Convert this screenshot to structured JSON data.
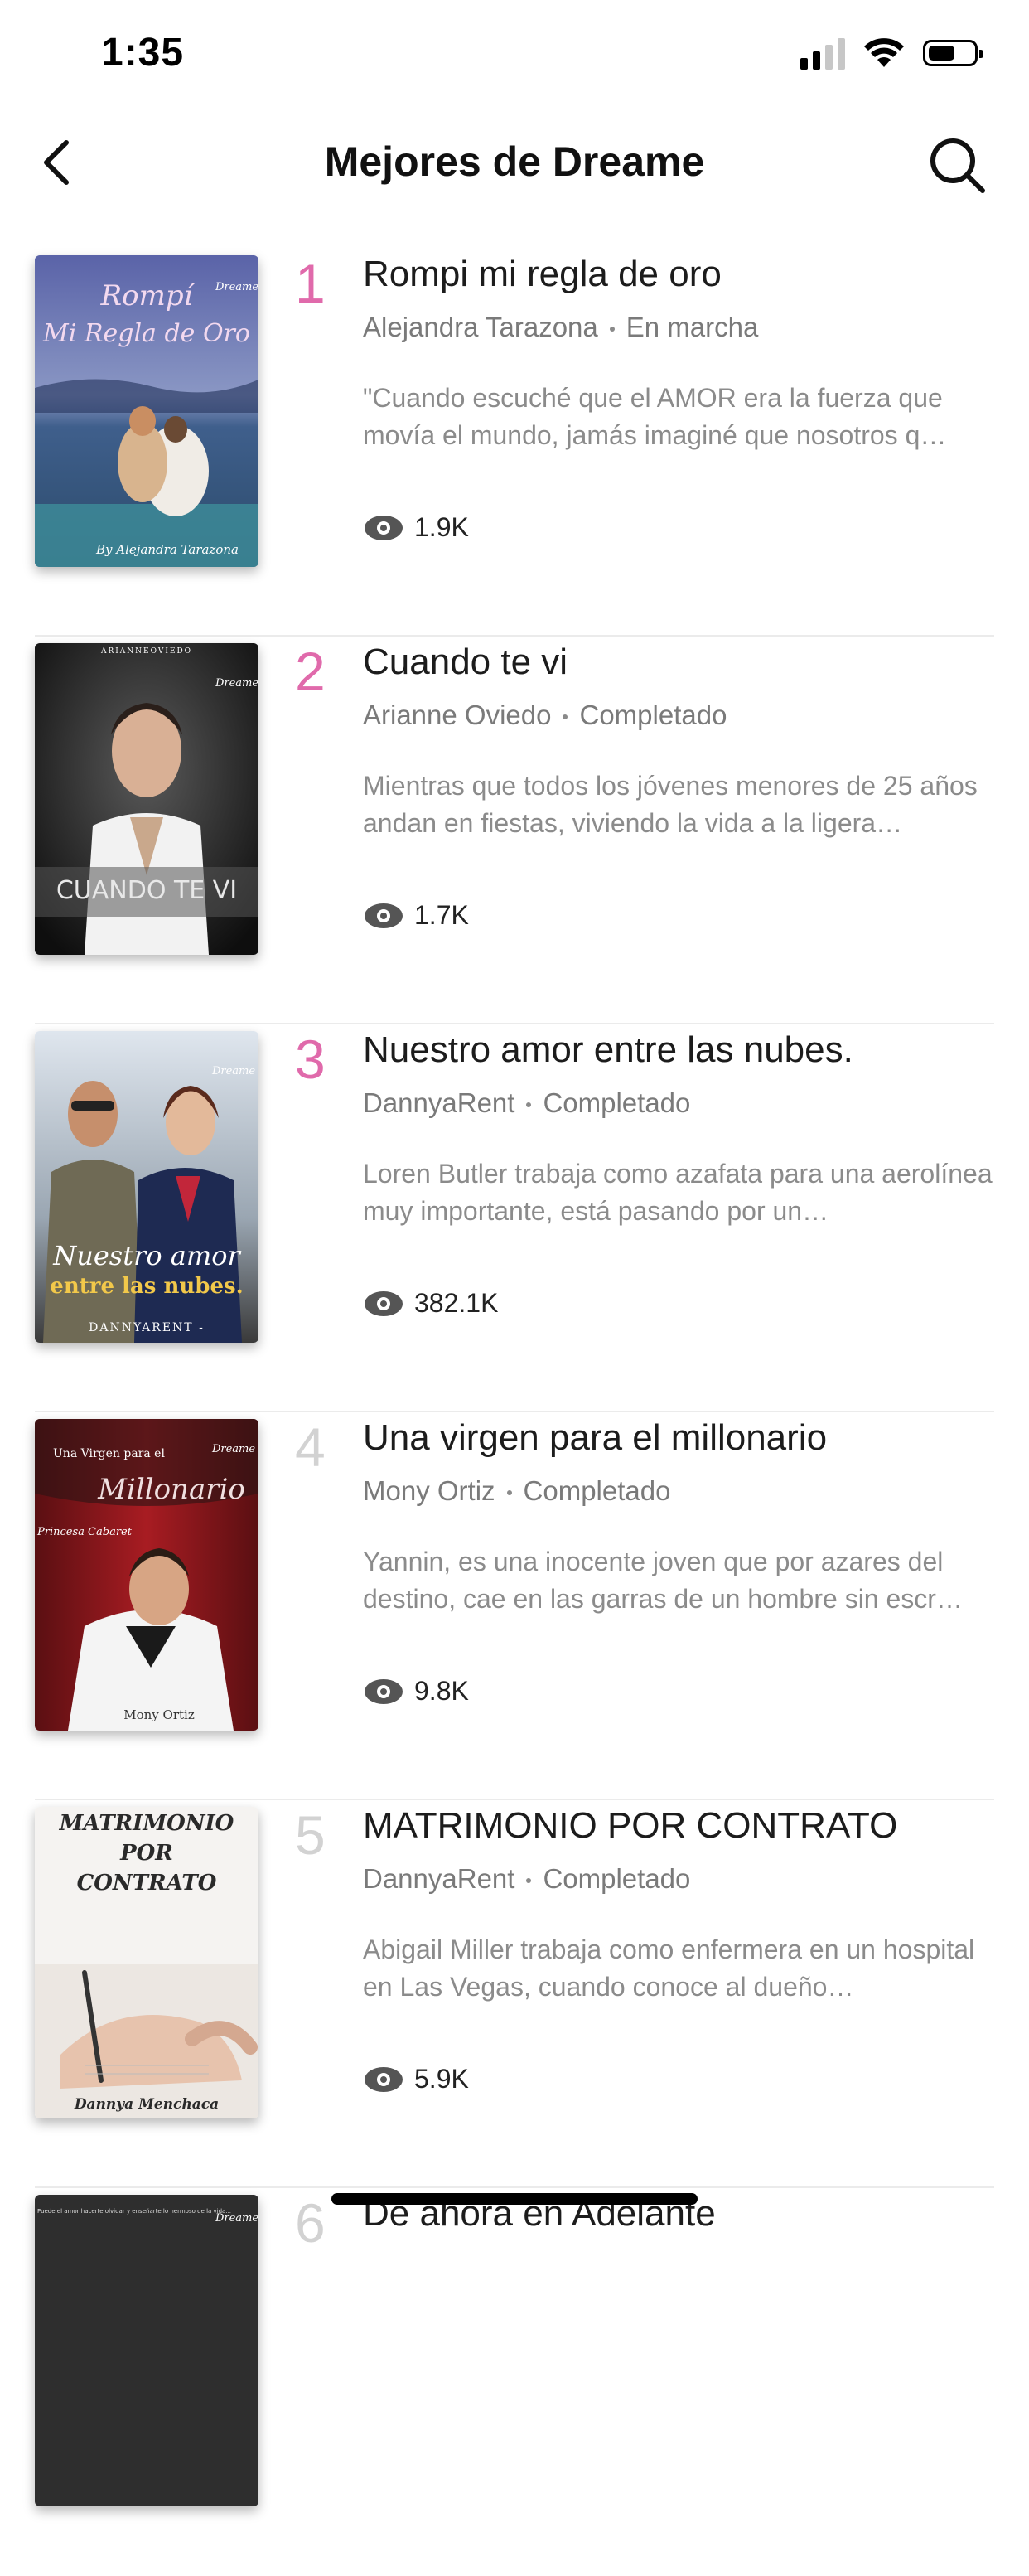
{
  "status_bar": {
    "time": "1:35",
    "battery_level": 0.6,
    "signal_bars": 2,
    "signal_total": 4
  },
  "nav": {
    "title": "Mejores de Dreame",
    "back_icon": "chevron-left-icon",
    "search_icon": "search-icon"
  },
  "colors": {
    "rank_top": "#e06aab",
    "rank_rest": "#d2d2d2",
    "text_dark": "#1c1c1c",
    "text_muted": "#7a7a7a"
  },
  "books": [
    {
      "rank": "1",
      "title": "Rompi mi regla de oro",
      "author": "Alejandra Tarazona",
      "status": "En marcha",
      "description": "\"Cuando escuché que el AMOR era la fuerza que movía el mundo, jamás imaginé que nosotros q…",
      "views": "1.9K",
      "cover": {
        "title_lines": [
          "Rompí",
          "Mi Regla de Oro"
        ],
        "author": "By Alejandra Tarazona",
        "brand": "Dreame"
      }
    },
    {
      "rank": "2",
      "title": "Cuando te vi",
      "author": "Arianne Oviedo",
      "status": "Completado",
      "description": "Mientras que todos los jóvenes menores de 25 años andan en fiestas, viviendo la vida a la ligera…",
      "views": "1.7K",
      "cover": {
        "title_lines": [
          "CUANDO TE VI"
        ],
        "author": "ARIANNEOVIEDO",
        "brand": "Dreame"
      }
    },
    {
      "rank": "3",
      "title": "Nuestro amor entre las nubes.",
      "author": "DannyaRent",
      "status": "Completado",
      "description": "Loren Butler trabaja como azafata para una aerolínea muy importante, está pasando por un…",
      "views": "382.1K",
      "cover": {
        "title_lines": [
          "Nuestro amor",
          "entre las nubes."
        ],
        "author": "DANNYARENT -",
        "brand": "Dreame"
      }
    },
    {
      "rank": "4",
      "title": "Una virgen para el millonario",
      "author": "Mony Ortiz",
      "status": "Completado",
      "description": "Yannin, es una inocente joven que por azares del destino, cae en las garras de un hombre sin escr…",
      "views": "9.8K",
      "cover": {
        "title_lines": [
          "Una Virgen para el",
          "Millonario"
        ],
        "author": "Mony Ortiz",
        "subtitle": "Princesa Cabaret",
        "brand": "Dreame"
      }
    },
    {
      "rank": "5",
      "title": "MATRIMONIO POR CONTRATO",
      "author": "DannyaRent",
      "status": "Completado",
      "description": "Abigail Miller trabaja como enfermera en un hospital en Las Vegas, cuando conoce al dueño…",
      "views": "5.9K",
      "cover": {
        "title_lines": [
          "MATRIMONIO",
          "POR",
          "CONTRATO"
        ],
        "author": "Dannya Menchaca",
        "brand": ""
      }
    },
    {
      "rank": "6",
      "title": "De ahora en Adelante",
      "author": "",
      "status": "",
      "description": "",
      "views": "",
      "cover": {
        "title_lines": [],
        "author": "",
        "tagline": "Puede el amor hacerte olvidar y enseñarte lo hermoso de la vida...",
        "brand": "Dreame"
      }
    }
  ]
}
